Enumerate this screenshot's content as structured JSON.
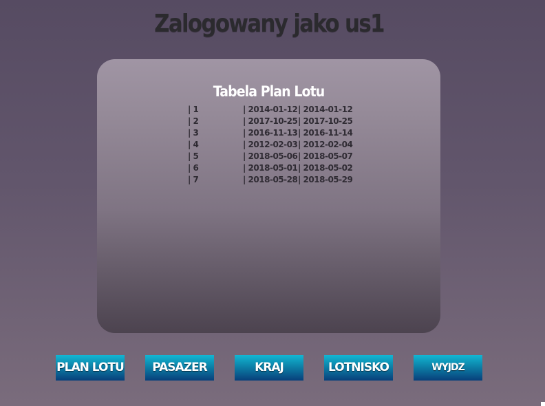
{
  "header": {
    "title": "Zalogowany jako us1"
  },
  "table": {
    "title": "Tabela Plan Lotu",
    "rows": [
      [
        "| 1",
        "| 2014-01-12",
        "| 2014-01-12"
      ],
      [
        "| 2",
        "| 2017-10-25",
        "| 2017-10-25"
      ],
      [
        "| 3",
        "| 2016-11-13",
        "| 2016-11-14"
      ],
      [
        "| 4",
        "| 2012-02-03",
        "| 2012-02-04"
      ],
      [
        "| 5",
        "| 2018-05-06",
        "| 2018-05-07"
      ],
      [
        "| 6",
        "| 2018-05-01",
        "| 2018-05-02"
      ],
      [
        "| 7",
        "| 2018-05-28",
        "| 2018-05-29"
      ]
    ]
  },
  "nav": {
    "buttons": [
      "PLAN LOTU",
      "PASAZER",
      "KRAJ",
      "LOTNISKO",
      "WYJDZ"
    ]
  }
}
